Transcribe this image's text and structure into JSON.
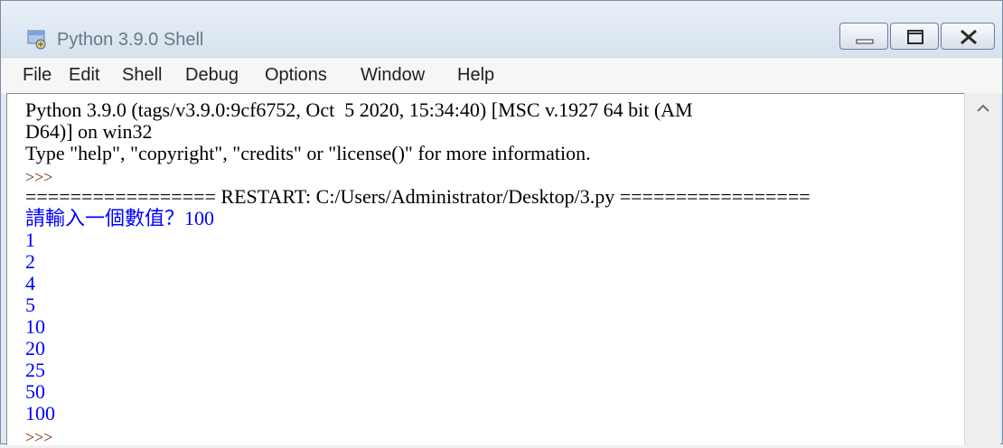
{
  "window": {
    "title": "Python 3.9.0 Shell",
    "icon": "python-idle-icon"
  },
  "controls": {
    "minimize_icon": "minimize-icon",
    "maximize_icon": "maximize-icon",
    "close_icon": "close-icon"
  },
  "menu": {
    "items": [
      "File",
      "Edit",
      "Shell",
      "Debug",
      "Options",
      "Window",
      "Help"
    ]
  },
  "shell": {
    "header_line1": "Python 3.9.0 (tags/v3.9.0:9cf6752, Oct  5 2020, 15:34:40) [MSC v.1927 64 bit (AM",
    "header_line2": "D64)] on win32",
    "header_line3": "Type \"help\", \"copyright\", \"credits\" or \"license()\" for more information.",
    "prompt": ">>>",
    "restart_line": "================= RESTART: C:/Users/Administrator/Desktop/3.py =================",
    "input_prompt": "請輸入一個數值？100",
    "outputs": [
      "1",
      "2",
      "4",
      "5",
      "10",
      "20",
      "25",
      "50",
      "100"
    ],
    "final_prompt": ">>>"
  },
  "colors": {
    "output_text": "#0000ff",
    "prompt_text": "#7a2400",
    "window_frame": "#dfe8f3"
  }
}
